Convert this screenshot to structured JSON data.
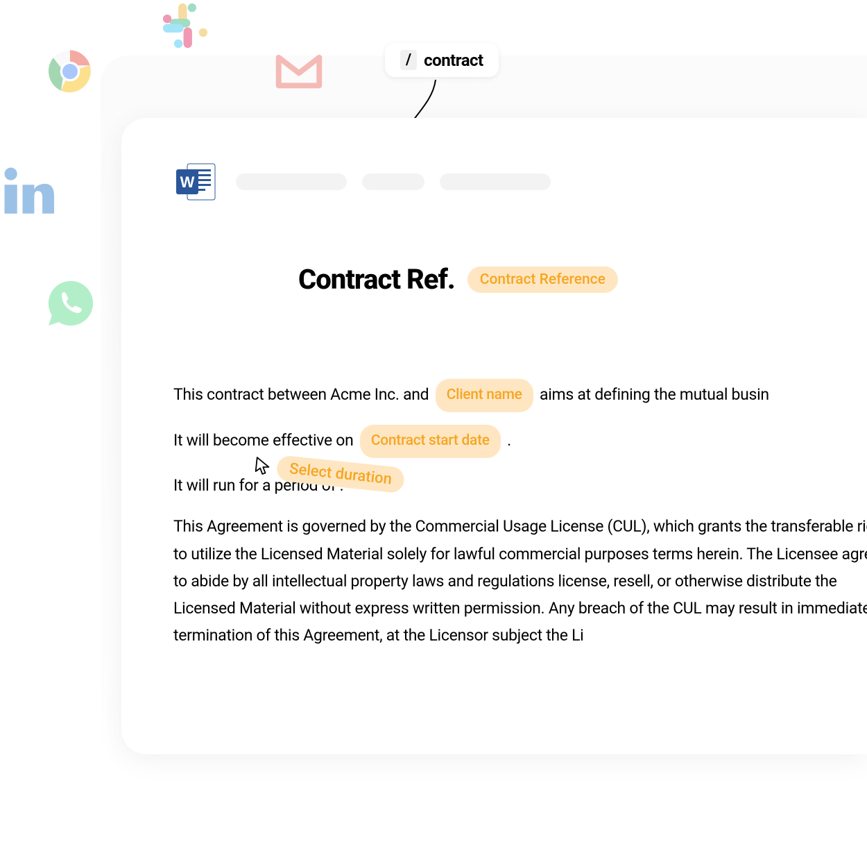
{
  "slash_command": {
    "key": "/",
    "text": "contract"
  },
  "icons": {
    "slack": "slack-icon",
    "chrome": "chrome-icon",
    "gmail": "gmail-icon",
    "linkedin": "linkedin-icon",
    "whatsapp": "whatsapp-icon",
    "word": "word-icon",
    "cursor": "cursor-icon"
  },
  "document": {
    "title": "Contract Ref.",
    "title_chip": "Contract Reference",
    "body": {
      "line1_prefix": "This contract between Acme Inc. and ",
      "line1_chip": "Client name",
      "line1_suffix": " aims at defining the mutual busin",
      "line2_prefix": "It will become effective on ",
      "line2_chip": "Contract start date",
      "line2_suffix": " .",
      "line3": "It will run for a period of  .",
      "paragraph": "This Agreement is governed by the Commercial Usage License (CUL), which grants the transferable rights to utilize the Licensed Material solely for lawful commercial purposes terms herein. The Licensee agrees to abide by all intellectual property laws and regulations license, resell, or otherwise distribute the Licensed Material without express written permission. Any breach of the CUL may result in immediate termination of this Agreement, at the Licensor subject the Li"
    }
  },
  "cursor_badge": {
    "label": "Select duration"
  }
}
